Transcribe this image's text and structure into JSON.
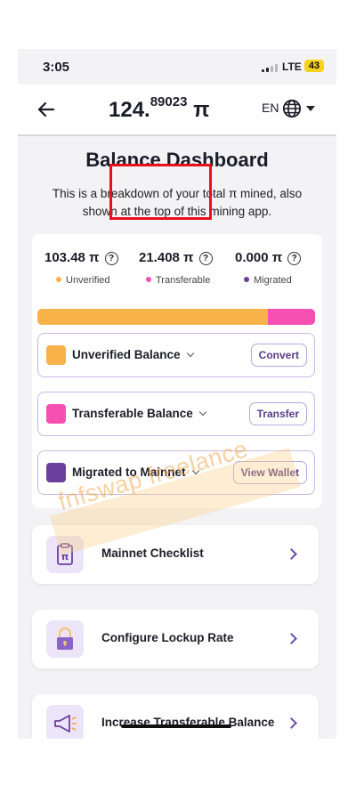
{
  "status_bar": {
    "time": "3:05",
    "network": "LTE",
    "battery": "43"
  },
  "header": {
    "balance_whole": "124.",
    "balance_fraction": "89023",
    "balance_unit": "π",
    "language": "EN"
  },
  "page": {
    "title": "Balance Dashboard",
    "description": "This is a breakdown of your total π mined, also shown at the top of this mining app."
  },
  "stats": [
    {
      "value": "103.48 π",
      "label": "Unverified",
      "color": "#f7b24a"
    },
    {
      "value": "21.408 π",
      "label": "Transferable",
      "color": "#f650b3"
    },
    {
      "value": "0.000 π",
      "label": "Migrated",
      "color": "#6b3fa0"
    }
  ],
  "help_icon_glyph": "?",
  "balance_bar": {
    "unverified_fraction": 0.83,
    "transferable_fraction": 0.17,
    "migrated_fraction": 0.0
  },
  "rows": [
    {
      "label": "Unverified Balance",
      "button": "Convert",
      "color": "#f7b24a"
    },
    {
      "label": "Transferable Balance",
      "button": "Transfer",
      "color": "#f650b3"
    },
    {
      "label": "Migrated to Mainnet",
      "button": "View Wallet",
      "color": "#6b3fa0"
    }
  ],
  "list_items": [
    {
      "label": "Mainnet Checklist",
      "icon": "clipboard-pi-icon"
    },
    {
      "label": "Configure Lockup Rate",
      "icon": "lock-icon"
    },
    {
      "label": "Increase Transferable Balance",
      "icon": "megaphone-icon"
    }
  ],
  "watermark": "fnfswap freelance",
  "colors": {
    "accent": "#6b3fa0",
    "highlight": "#e8101a"
  }
}
